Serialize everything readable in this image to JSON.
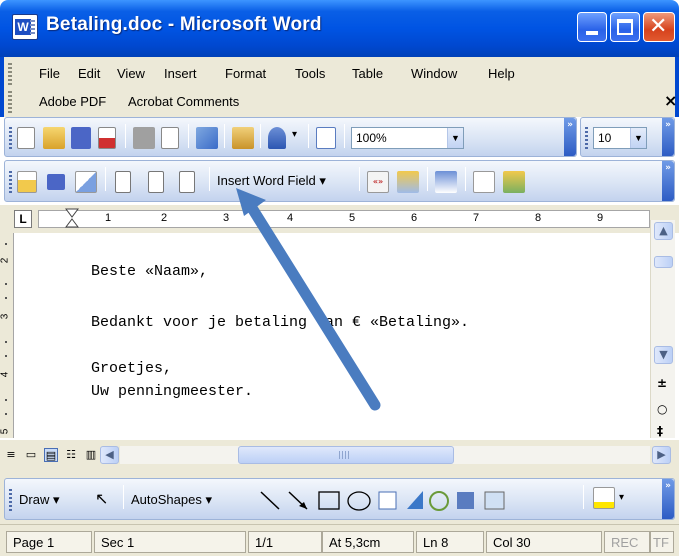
{
  "window": {
    "title": "Betaling.doc - Microsoft Word",
    "app_icon_letter": "W",
    "close_glyph": "✕"
  },
  "menu": {
    "row1": [
      "File",
      "Edit",
      "View",
      "Insert",
      "Format",
      "Tools",
      "Table",
      "Window",
      "Help"
    ],
    "row2": [
      "Adobe PDF",
      "Acrobat Comments"
    ],
    "close_glyph": "×"
  },
  "standard_toolbar": {
    "zoom_value": "100%",
    "font_size_value": "10",
    "chevron": "»"
  },
  "mail_merge_toolbar": {
    "insert_word_field_label": "Insert Word Field ▾",
    "chevron": "»"
  },
  "ruler": {
    "corner_glyph": "L",
    "numbers": [
      "1",
      "2",
      "3",
      "4",
      "5",
      "6",
      "7",
      "8",
      "9"
    ],
    "vertical_numbers": [
      "2",
      "3",
      "4",
      "5"
    ]
  },
  "document": {
    "lines": [
      "Beste «Naam»,",
      "Bedankt voor je betaling van € «Betaling».",
      "Groetjes,",
      "Uw penningmeester."
    ]
  },
  "scrollbar": {
    "up": "▲",
    "down": "▼",
    "browse_prev": "±",
    "browse_select": "○",
    "browse_next": "‡",
    "left": "◀",
    "right": "▶"
  },
  "view_buttons": [
    "≡",
    "▭",
    "▤",
    "☷",
    "▥"
  ],
  "drawing_toolbar": {
    "draw_label": "Draw ▾",
    "autoshapes_label": "AutoShapes ▾",
    "chevron": "»"
  },
  "statusbar": {
    "page": "Page 1",
    "sec": "Sec 1",
    "pages": "1/1",
    "at": "At 5,3cm",
    "ln": "Ln 8",
    "col": "Col 30",
    "rec": "REC",
    "trk": "TF"
  },
  "colors": {
    "titlebar_blue": "#0054e3",
    "chrome": "#ece9d8",
    "annotation_arrow": "#4a7cc0"
  }
}
